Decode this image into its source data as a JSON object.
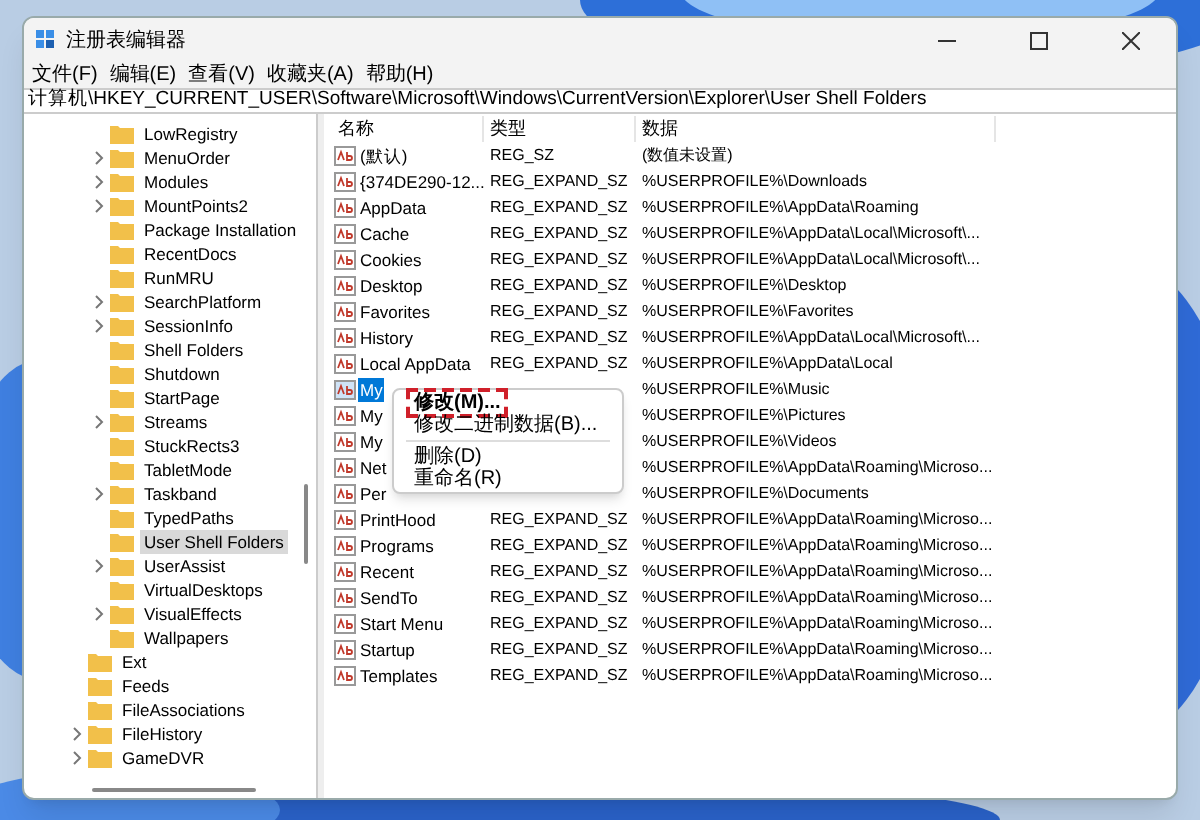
{
  "window": {
    "title": "注册表编辑器"
  },
  "menu": [
    "文件(F)",
    "编辑(E)",
    "查看(V)",
    "收藏夹(A)",
    "帮助(H)"
  ],
  "address": "计算机\\HKEY_CURRENT_USER\\Software\\Microsoft\\Windows\\CurrentVersion\\Explorer\\User Shell Folders",
  "tree": {
    "explorer_subkeys": [
      {
        "label": "LowRegistry",
        "expandable": false,
        "selected": false
      },
      {
        "label": "MenuOrder",
        "expandable": true,
        "selected": false
      },
      {
        "label": "Modules",
        "expandable": true,
        "selected": false
      },
      {
        "label": "MountPoints2",
        "expandable": true,
        "selected": false
      },
      {
        "label": "Package Installation",
        "expandable": false,
        "selected": false
      },
      {
        "label": "RecentDocs",
        "expandable": false,
        "selected": false
      },
      {
        "label": "RunMRU",
        "expandable": false,
        "selected": false
      },
      {
        "label": "SearchPlatform",
        "expandable": true,
        "selected": false
      },
      {
        "label": "SessionInfo",
        "expandable": true,
        "selected": false
      },
      {
        "label": "Shell Folders",
        "expandable": false,
        "selected": false
      },
      {
        "label": "Shutdown",
        "expandable": false,
        "selected": false
      },
      {
        "label": "StartPage",
        "expandable": false,
        "selected": false
      },
      {
        "label": "Streams",
        "expandable": true,
        "selected": false
      },
      {
        "label": "StuckRects3",
        "expandable": false,
        "selected": false
      },
      {
        "label": "TabletMode",
        "expandable": false,
        "selected": false
      },
      {
        "label": "Taskband",
        "expandable": true,
        "selected": false
      },
      {
        "label": "TypedPaths",
        "expandable": false,
        "selected": false
      },
      {
        "label": "User Shell Folders",
        "expandable": false,
        "selected": true
      },
      {
        "label": "UserAssist",
        "expandable": true,
        "selected": false
      },
      {
        "label": "VirtualDesktops",
        "expandable": false,
        "selected": false
      },
      {
        "label": "VisualEffects",
        "expandable": true,
        "selected": false
      },
      {
        "label": "Wallpapers",
        "expandable": false,
        "selected": false
      }
    ],
    "sibling_keys": [
      {
        "label": "Ext",
        "expandable": false,
        "selected": false
      },
      {
        "label": "Feeds",
        "expandable": false,
        "selected": false
      },
      {
        "label": "FileAssociations",
        "expandable": false,
        "selected": false
      },
      {
        "label": "FileHistory",
        "expandable": true,
        "selected": false
      },
      {
        "label": "GameDVR",
        "expandable": true,
        "selected": false
      }
    ]
  },
  "table": {
    "columns": [
      "名称",
      "类型",
      "数据"
    ],
    "rows": [
      {
        "name": "(默认)",
        "type": "REG_SZ",
        "data": "(数值未设置)",
        "selected": false
      },
      {
        "name": "{374DE290-12...",
        "type": "REG_EXPAND_SZ",
        "data": "%USERPROFILE%\\Downloads",
        "selected": false
      },
      {
        "name": "AppData",
        "type": "REG_EXPAND_SZ",
        "data": "%USERPROFILE%\\AppData\\Roaming",
        "selected": false
      },
      {
        "name": "Cache",
        "type": "REG_EXPAND_SZ",
        "data": "%USERPROFILE%\\AppData\\Local\\Microsoft\\...",
        "selected": false
      },
      {
        "name": "Cookies",
        "type": "REG_EXPAND_SZ",
        "data": "%USERPROFILE%\\AppData\\Local\\Microsoft\\...",
        "selected": false
      },
      {
        "name": "Desktop",
        "type": "REG_EXPAND_SZ",
        "data": "%USERPROFILE%\\Desktop",
        "selected": false
      },
      {
        "name": "Favorites",
        "type": "REG_EXPAND_SZ",
        "data": "%USERPROFILE%\\Favorites",
        "selected": false
      },
      {
        "name": "History",
        "type": "REG_EXPAND_SZ",
        "data": "%USERPROFILE%\\AppData\\Local\\Microsoft\\...",
        "selected": false
      },
      {
        "name": "Local AppData",
        "type": "REG_EXPAND_SZ",
        "data": "%USERPROFILE%\\AppData\\Local",
        "selected": false
      },
      {
        "name": "My",
        "data": "%USERPROFILE%\\Music",
        "selected": true
      },
      {
        "name": "My",
        "data": "%USERPROFILE%\\Pictures",
        "selected": false
      },
      {
        "name": "My",
        "data": "%USERPROFILE%\\Videos",
        "selected": false
      },
      {
        "name": "Net",
        "data": "%USERPROFILE%\\AppData\\Roaming\\Microso...",
        "selected": false
      },
      {
        "name": "Per",
        "data": "%USERPROFILE%\\Documents",
        "selected": false
      },
      {
        "name": "PrintHood",
        "type": "REG_EXPAND_SZ",
        "data": "%USERPROFILE%\\AppData\\Roaming\\Microso...",
        "selected": false
      },
      {
        "name": "Programs",
        "type": "REG_EXPAND_SZ",
        "data": "%USERPROFILE%\\AppData\\Roaming\\Microso...",
        "selected": false
      },
      {
        "name": "Recent",
        "type": "REG_EXPAND_SZ",
        "data": "%USERPROFILE%\\AppData\\Roaming\\Microso...",
        "selected": false
      },
      {
        "name": "SendTo",
        "type": "REG_EXPAND_SZ",
        "data": "%USERPROFILE%\\AppData\\Roaming\\Microso...",
        "selected": false
      },
      {
        "name": "Start Menu",
        "type": "REG_EXPAND_SZ",
        "data": "%USERPROFILE%\\AppData\\Roaming\\Microso...",
        "selected": false
      },
      {
        "name": "Startup",
        "type": "REG_EXPAND_SZ",
        "data": "%USERPROFILE%\\AppData\\Roaming\\Microso...",
        "selected": false
      },
      {
        "name": "Templates",
        "type": "REG_EXPAND_SZ",
        "data": "%USERPROFILE%\\AppData\\Roaming\\Microso...",
        "selected": false
      }
    ]
  },
  "context_menu": {
    "items": [
      {
        "kind": "item",
        "label": "修改(M)...",
        "highlighted": true
      },
      {
        "kind": "item",
        "label": "修改二进制数据(B)...",
        "highlighted": false
      },
      {
        "kind": "separator"
      },
      {
        "kind": "item",
        "label": "删除(D)",
        "highlighted": false
      },
      {
        "kind": "item",
        "label": "重命名(R)",
        "highlighted": false
      }
    ]
  }
}
